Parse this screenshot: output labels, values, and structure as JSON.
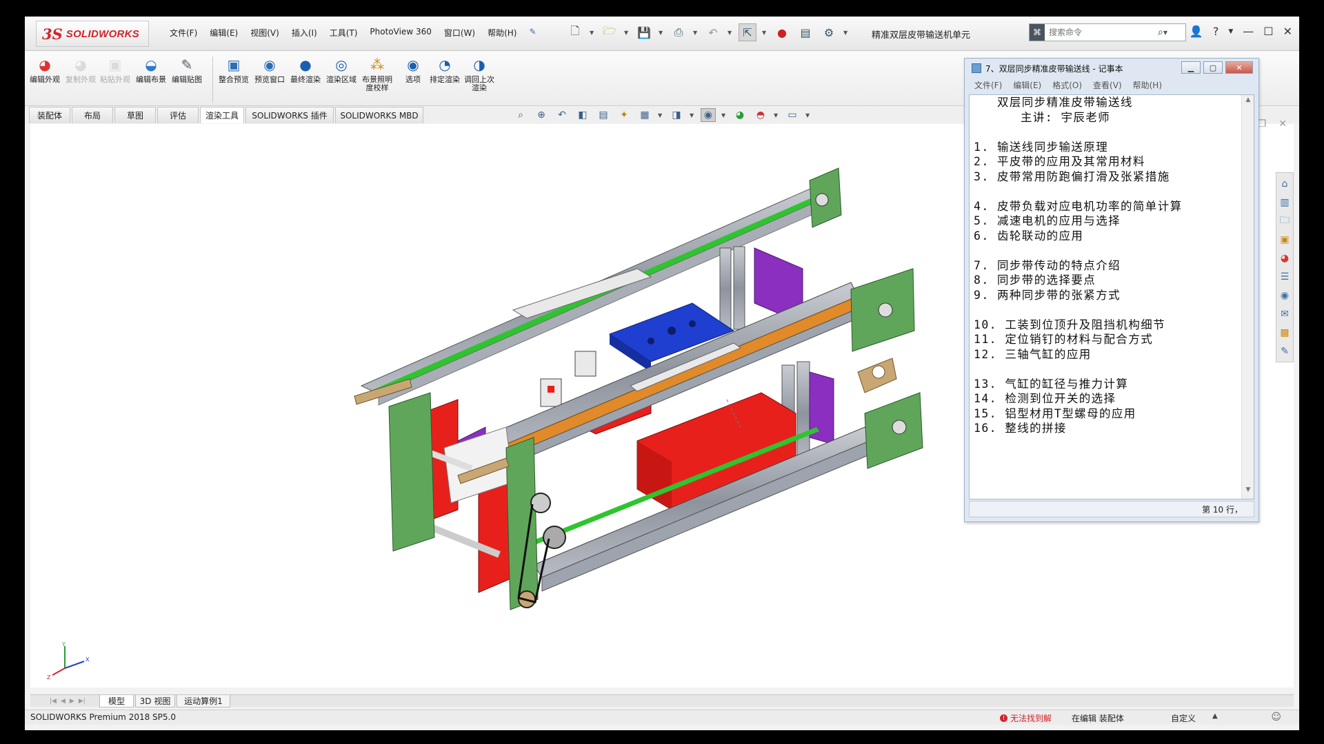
{
  "app": {
    "logo_ds": "3S",
    "logo_text": "SOLIDWORKS",
    "doc_title": "精准双层皮带输送机单元"
  },
  "menu": [
    "文件(F)",
    "编辑(E)",
    "视图(V)",
    "插入(I)",
    "工具(T)",
    "PhotoView 360",
    "窗口(W)",
    "帮助(H)"
  ],
  "search": {
    "placeholder": "搜索命令"
  },
  "commands": [
    {
      "label": "编辑外观",
      "icon": "edit-appearance-icon",
      "enabled": true
    },
    {
      "label": "复制外观",
      "icon": "copy-appearance-icon",
      "enabled": false
    },
    {
      "label": "粘贴外观",
      "icon": "paste-appearance-icon",
      "enabled": false
    },
    {
      "label": "编辑布景",
      "icon": "edit-scene-icon",
      "enabled": true
    },
    {
      "label": "编辑贴图",
      "icon": "edit-decal-icon",
      "enabled": true
    },
    {
      "label": "整合预览",
      "icon": "integrated-preview-icon",
      "enabled": true
    },
    {
      "label": "预览窗口",
      "icon": "preview-window-icon",
      "enabled": true
    },
    {
      "label": "最终渲染",
      "icon": "final-render-icon",
      "enabled": true
    },
    {
      "label": "渲染区域",
      "icon": "render-region-icon",
      "enabled": true
    },
    {
      "label": "布景照明度校样",
      "icon": "scene-illumination-icon",
      "enabled": true
    },
    {
      "label": "选项",
      "icon": "options-icon",
      "enabled": true
    },
    {
      "label": "排定渲染",
      "icon": "schedule-render-icon",
      "enabled": true
    },
    {
      "label": "调回上次渲染",
      "icon": "recall-render-icon",
      "enabled": true
    }
  ],
  "cm_tabs": [
    "装配体",
    "布局",
    "草图",
    "评估",
    "渲染工具",
    "SOLIDWORKS 插件",
    "SOLIDWORKS MBD"
  ],
  "cm_active_tab": "渲染工具",
  "notepad": {
    "title": "7、双层同步精准皮带输送线 - 记事本",
    "menu": [
      "文件(F)",
      "编辑(E)",
      "格式(O)",
      "查看(V)",
      "帮助(H)"
    ],
    "lines": [
      "   双层同步精准皮带输送线",
      "      主讲: 宇辰老师",
      "",
      "1. 输送线同步输送原理",
      "2. 平皮带的应用及其常用材料",
      "3. 皮带常用防跑偏打滑及张紧措施",
      "",
      "4. 皮带负载对应电机功率的简单计算",
      "5. 减速电机的应用与选择",
      "6. 齿轮联动的应用",
      "",
      "7. 同步带传动的特点介绍",
      "8. 同步带的选择要点",
      "9. 两种同步带的张紧方式",
      "",
      "10. 工装到位顶升及阻挡机构细节",
      "11. 定位销钉的材料与配合方式",
      "12. 三轴气缸的应用",
      "",
      "13. 气缸的缸径与推力计算",
      "14. 检测到位开关的选择",
      "15. 铝型材用T型螺母的应用",
      "16. 整线的拼接"
    ],
    "status": "第 10 行，"
  },
  "bottom_tabs": [
    "模型",
    "3D 视图",
    "运动算例1"
  ],
  "bottom_active_tab": "模型",
  "status": {
    "version": "SOLIDWORKS Premium 2018 SP5.0",
    "warning": "无法找到解",
    "editing": "在编辑 装配体",
    "units": "自定义"
  },
  "triad": {
    "x": "X",
    "y": "Y",
    "z": "Z"
  },
  "colors": {
    "frame_green": "#5fa65a",
    "plate_red": "#e8201c",
    "block_blue": "#1f3fd0",
    "bracket_purple": "#8a2fbf",
    "aluminum": "#9ea4ae",
    "tan_plate": "#c9a774",
    "belt_green": "#2fc42f",
    "belt_orange": "#e08a2a"
  }
}
